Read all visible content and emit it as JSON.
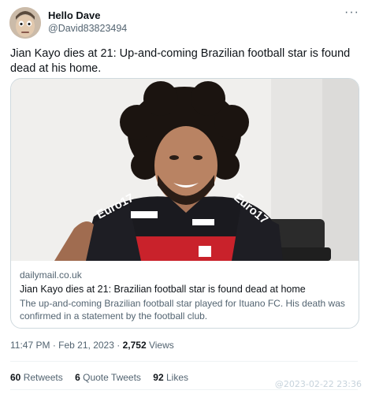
{
  "author": {
    "name": "Hello Dave",
    "handle": "@David83823494"
  },
  "menu_icon": "more-horizontal-icon",
  "tweet_text": "Jian Kayo dies at 21: Up-and-coming Brazilian football star is found dead at his home.",
  "card": {
    "domain": "dailymail.co.uk",
    "title": "Jian Kayo dies at 21: Brazilian football star is found dead at home",
    "description": "The up-and-coming Brazilian football star played for Ituano FC. His death was confirmed in a statement by the football club.",
    "jersey_text": "Euro17"
  },
  "meta": {
    "time": "11:47 PM",
    "separator": "·",
    "date": "Feb 21, 2023",
    "views_count": "2,752",
    "views_label": "Views"
  },
  "stats": {
    "retweets_count": "60",
    "retweets_label": "Retweets",
    "quotes_count": "6",
    "quotes_label": "Quote Tweets",
    "likes_count": "92",
    "likes_label": "Likes"
  },
  "watermark": "@2023-02-22 23:36",
  "colors": {
    "text_primary": "#0f1419",
    "text_secondary": "#536471",
    "border": "#cfd9de"
  }
}
